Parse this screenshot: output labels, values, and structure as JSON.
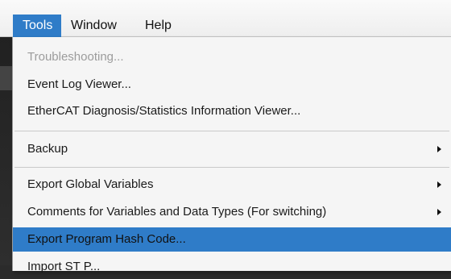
{
  "menubar": {
    "items": [
      {
        "label": "Tools",
        "active": true
      },
      {
        "label": "Window",
        "active": false
      },
      {
        "label": "Help",
        "active": false
      }
    ]
  },
  "tools_menu": {
    "items": [
      {
        "label": "Troubleshooting...",
        "enabled": false,
        "submenu": false,
        "highlighted": false
      },
      {
        "label": "Event Log Viewer...",
        "enabled": true,
        "submenu": false,
        "highlighted": false
      },
      {
        "label": "EtherCAT Diagnosis/Statistics Information Viewer...",
        "enabled": true,
        "submenu": false,
        "highlighted": false
      },
      {
        "label": "Backup",
        "enabled": true,
        "submenu": true,
        "highlighted": false
      },
      {
        "label": "Export Global Variables",
        "enabled": true,
        "submenu": true,
        "highlighted": false
      },
      {
        "label": "Comments for Variables and Data Types (For switching)",
        "enabled": true,
        "submenu": true,
        "highlighted": false
      },
      {
        "label": "Export Program Hash Code...",
        "enabled": true,
        "submenu": false,
        "highlighted": true
      },
      {
        "label": "Import ST P...",
        "enabled": true,
        "submenu": false,
        "highlighted": false
      }
    ]
  },
  "colors": {
    "highlight": "#2f7cc8",
    "menu_bg": "#f5f5f5",
    "disabled_text": "#9c9c9c"
  }
}
